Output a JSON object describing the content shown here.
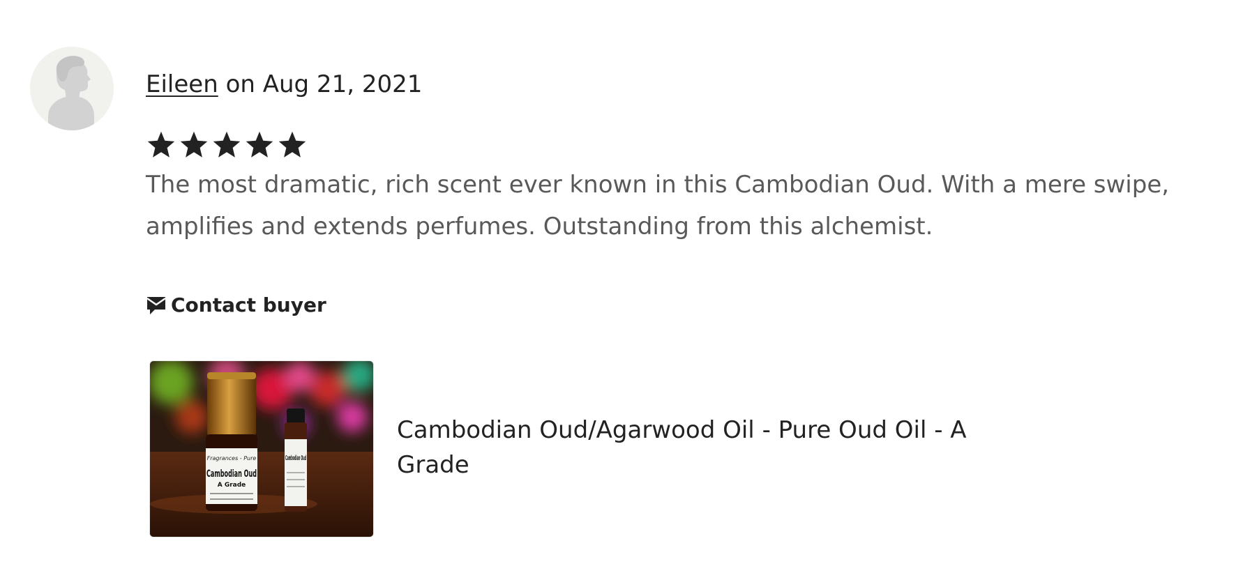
{
  "review": {
    "reviewer_name": "Eileen",
    "date_text": "on Aug 21, 2021",
    "rating": 5,
    "rating_max": 5,
    "text": "The most dramatic, rich scent ever known in this Cambodian Oud. With a mere swipe, amplifies and extends perfumes. Outstanding from this alchemist.",
    "contact_label": "Contact buyer",
    "contact_icon": "envelope-icon"
  },
  "listing": {
    "title": "Cambodian Oud/Agarwood Oil - Pure Oud Oil - A Grade",
    "image_label_brand": "Fragrances - Pure",
    "image_label_product": "Cambodian Oud",
    "image_label_grade": "A Grade"
  },
  "colors": {
    "text_primary": "#222222",
    "text_secondary": "#595959",
    "star": "#222222",
    "avatar_bg": "#f1f1ed",
    "avatar_silhouette": "#d2d2d2"
  }
}
